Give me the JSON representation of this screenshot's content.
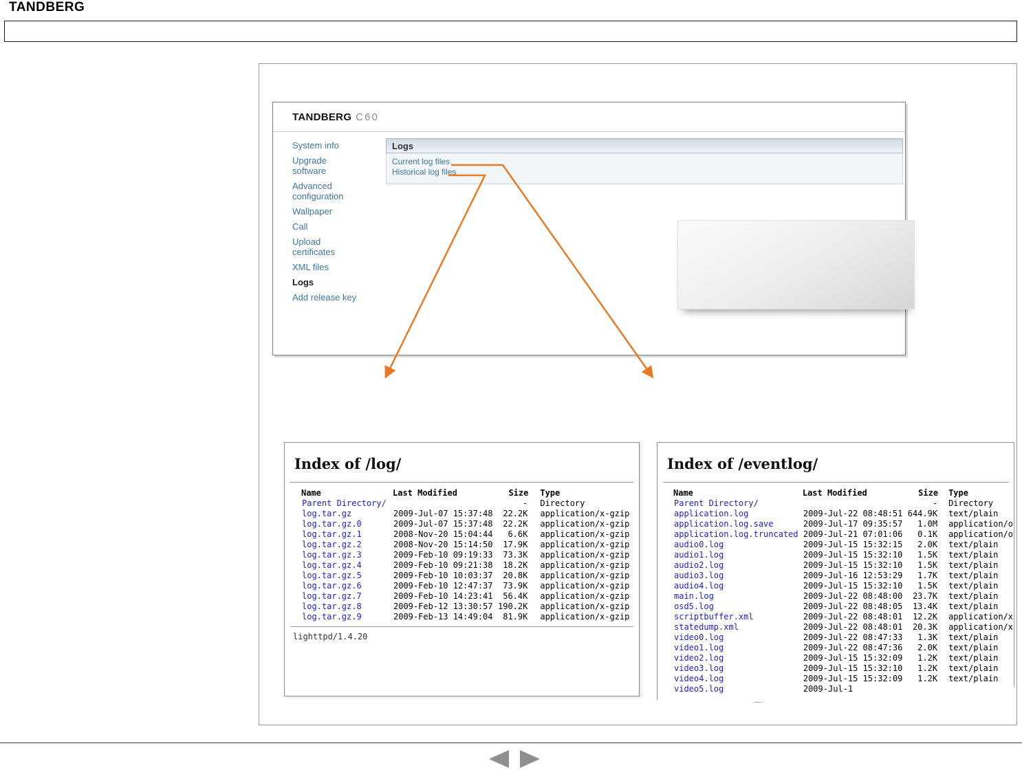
{
  "page": {
    "brand": "TANDBERG"
  },
  "device_ui": {
    "brand": "TANDBERG",
    "model": "C60",
    "sidebar": [
      {
        "label": "System info",
        "active": false
      },
      {
        "label": "Upgrade software",
        "active": false
      },
      {
        "label": "Advanced configuration",
        "active": false
      },
      {
        "label": "Wallpaper",
        "active": false
      },
      {
        "label": "Call",
        "active": false
      },
      {
        "label": "Upload certificates",
        "active": false
      },
      {
        "label": "XML files",
        "active": false
      },
      {
        "label": "Logs",
        "active": true
      },
      {
        "label": "Add release key",
        "active": false
      }
    ],
    "page_title": "Logs",
    "links": [
      "Current log files",
      "Historical log files"
    ]
  },
  "annotations": {
    "arrow_color": "#e87a24"
  },
  "log_listing": {
    "title": "Index of /log/",
    "columns": [
      "Name",
      "Last Modified",
      "Size",
      "Type"
    ],
    "rows": [
      {
        "name": "Parent Directory/",
        "modified": "",
        "size": "-",
        "type": "Directory"
      },
      {
        "name": "log.tar.gz",
        "modified": "2009-Jul-07 15:37:48",
        "size": "22.2K",
        "type": "application/x-gzip"
      },
      {
        "name": "log.tar.gz.0",
        "modified": "2009-Jul-07 15:37:48",
        "size": "22.2K",
        "type": "application/x-gzip"
      },
      {
        "name": "log.tar.gz.1",
        "modified": "2008-Nov-20 15:04:44",
        "size": "6.6K",
        "type": "application/x-gzip"
      },
      {
        "name": "log.tar.gz.2",
        "modified": "2008-Nov-20 15:14:50",
        "size": "17.9K",
        "type": "application/x-gzip"
      },
      {
        "name": "log.tar.gz.3",
        "modified": "2009-Feb-10 09:19:33",
        "size": "73.3K",
        "type": "application/x-gzip"
      },
      {
        "name": "log.tar.gz.4",
        "modified": "2009-Feb-10 09:21:38",
        "size": "18.2K",
        "type": "application/x-gzip"
      },
      {
        "name": "log.tar.gz.5",
        "modified": "2009-Feb-10 10:03:37",
        "size": "20.8K",
        "type": "application/x-gzip"
      },
      {
        "name": "log.tar.gz.6",
        "modified": "2009-Feb-10 12:47:37",
        "size": "73.9K",
        "type": "application/x-gzip"
      },
      {
        "name": "log.tar.gz.7",
        "modified": "2009-Feb-10 14:23:41",
        "size": "56.4K",
        "type": "application/x-gzip"
      },
      {
        "name": "log.tar.gz.8",
        "modified": "2009-Feb-12 13:30:57",
        "size": "190.2K",
        "type": "application/x-gzip"
      },
      {
        "name": "log.tar.gz.9",
        "modified": "2009-Feb-13 14:49:04",
        "size": "81.9K",
        "type": "application/x-gzip"
      }
    ],
    "footer": "lighttpd/1.4.20"
  },
  "eventlog_listing": {
    "title": "Index of /eventlog/",
    "columns": [
      "Name",
      "Last Modified",
      "Size",
      "Type"
    ],
    "rows": [
      {
        "name": "Parent Directory/",
        "modified": "",
        "size": "-",
        "type": "Directory"
      },
      {
        "name": "application.log",
        "modified": "2009-Jul-22 08:48:51",
        "size": "644.9K",
        "type": "text/plain"
      },
      {
        "name": "application.log.save",
        "modified": "2009-Jul-17 09:35:57",
        "size": "1.0M",
        "type": "application/o"
      },
      {
        "name": "application.log.truncated",
        "modified": "2009-Jul-21 07:01:06",
        "size": "0.1K",
        "type": "application/o"
      },
      {
        "name": "audio0.log",
        "modified": "2009-Jul-15 15:32:15",
        "size": "2.0K",
        "type": "text/plain"
      },
      {
        "name": "audio1.log",
        "modified": "2009-Jul-15 15:32:10",
        "size": "1.5K",
        "type": "text/plain"
      },
      {
        "name": "audio2.log",
        "modified": "2009-Jul-15 15:32:10",
        "size": "1.5K",
        "type": "text/plain"
      },
      {
        "name": "audio3.log",
        "modified": "2009-Jul-16 12:53:29",
        "size": "1.7K",
        "type": "text/plain"
      },
      {
        "name": "audio4.log",
        "modified": "2009-Jul-15 15:32:10",
        "size": "1.5K",
        "type": "text/plain"
      },
      {
        "name": "main.log",
        "modified": "2009-Jul-22 08:48:00",
        "size": "23.7K",
        "type": "text/plain"
      },
      {
        "name": "osd5.log",
        "modified": "2009-Jul-22 08:48:05",
        "size": "13.4K",
        "type": "text/plain"
      },
      {
        "name": "scriptbuffer.xml",
        "modified": "2009-Jul-22 08:48:01",
        "size": "12.2K",
        "type": "application/x"
      },
      {
        "name": "statedump.xml",
        "modified": "2009-Jul-22 08:48:01",
        "size": "20.3K",
        "type": "application/x"
      },
      {
        "name": "video0.log",
        "modified": "2009-Jul-22 08:47:33",
        "size": "1.3K",
        "type": "text/plain"
      },
      {
        "name": "video1.log",
        "modified": "2009-Jul-22 08:47:36",
        "size": "2.0K",
        "type": "text/plain"
      },
      {
        "name": "video2.log",
        "modified": "2009-Jul-15 15:32:09",
        "size": "1.2K",
        "type": "text/plain"
      },
      {
        "name": "video3.log",
        "modified": "2009-Jul-15 15:32:10",
        "size": "1.2K",
        "type": "text/plain"
      },
      {
        "name": "video4.log",
        "modified": "2009-Jul-15 15:32:09",
        "size": "1.2K",
        "type": "text/plain"
      },
      {
        "name": "video5.log",
        "modified": "2009-Jul-1",
        "size": "",
        "type": ""
      }
    ]
  }
}
